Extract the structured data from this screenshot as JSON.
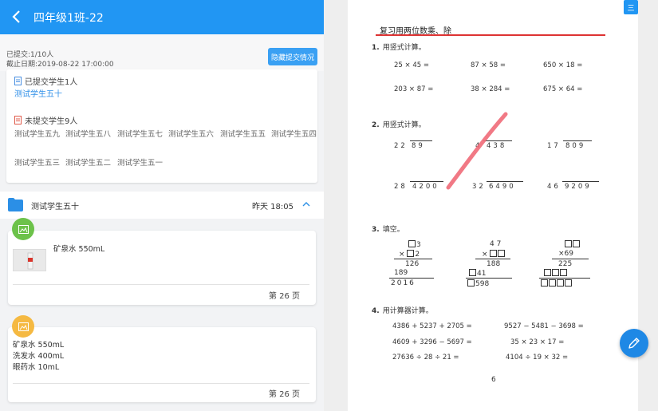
{
  "header": {
    "title": "四年级1班-22"
  },
  "submit": {
    "count": "已提交:1/10人",
    "deadline": "截止日期:2019-08-22 17:00:00",
    "hide_button": "隐藏提交情况"
  },
  "status": {
    "submitted_label": "已提交学生1人",
    "submitted_student": "测试学生五十",
    "pending_label": "未提交学生9人",
    "pending": [
      "测试学生五九",
      "测试学生五八",
      "测试学生五七",
      "测试学生五六",
      "测试学生五五",
      "测试学生五四",
      "测试学生五三",
      "测试学生五二",
      "测试学生五一"
    ]
  },
  "student_bar": {
    "name": "测试学生五十",
    "time": "昨天 18:05"
  },
  "cards": [
    {
      "lines": [
        "矿泉水 550mL"
      ],
      "page": "第 26 页",
      "badge_color": "#6cc24a"
    },
    {
      "lines": [
        "矿泉水 550mL",
        "洗发水 400mL",
        "眼药水 10mL"
      ],
      "page": "第 26 页",
      "badge_color": "#f5b942"
    }
  ],
  "doc": {
    "title": "复习用两位数乘、除",
    "q1": {
      "num": "1.",
      "text": "用竖式计算。",
      "rows": [
        [
          "25 × 45 =",
          "87 × 58 =",
          "650 × 18 ="
        ],
        [
          "203 × 87 =",
          "38 × 284 =",
          "675 × 64 ="
        ]
      ]
    },
    "q2": {
      "num": "2.",
      "text": "用竖式计算。",
      "rows": [
        [
          "22",
          "89",
          "4",
          "438",
          "17",
          "809"
        ],
        [
          "28",
          "4200",
          "32",
          "6490",
          "46",
          "9209"
        ]
      ]
    },
    "q3": {
      "num": "3.",
      "text": "填空。"
    },
    "q3_digits": {
      "a": [
        "3",
        "×",
        "2",
        "126",
        "189",
        "2016"
      ],
      "b": [
        "4 7",
        "188",
        "41",
        "598"
      ],
      "c": [
        "×69",
        "225"
      ]
    },
    "q4": {
      "num": "4.",
      "text": "用计算器计算。",
      "rows": [
        [
          "4386 + 5237 + 2705 =",
          "9527 − 5481 − 3698 ="
        ],
        [
          "4609 + 3296 − 5697 =",
          "35 × 23 × 17 ="
        ],
        [
          "27636 ÷ 28 ÷ 21 =",
          "4104 ÷ 19 × 32 ="
        ]
      ]
    },
    "page_number": "6",
    "corner_icon": "三"
  }
}
